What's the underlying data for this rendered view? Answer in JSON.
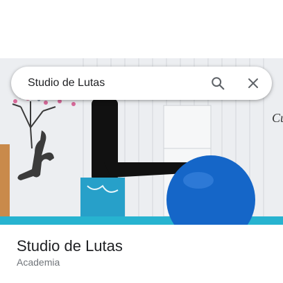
{
  "search": {
    "query": "Studio de Lutas"
  },
  "icons": {
    "search": "search-icon",
    "close": "close-icon"
  },
  "place": {
    "title": "Studio de Lutas",
    "category": "Academia"
  },
  "colors": {
    "title_text": "#202124",
    "secondary_text": "#70757a",
    "icon": "#5f6368"
  }
}
